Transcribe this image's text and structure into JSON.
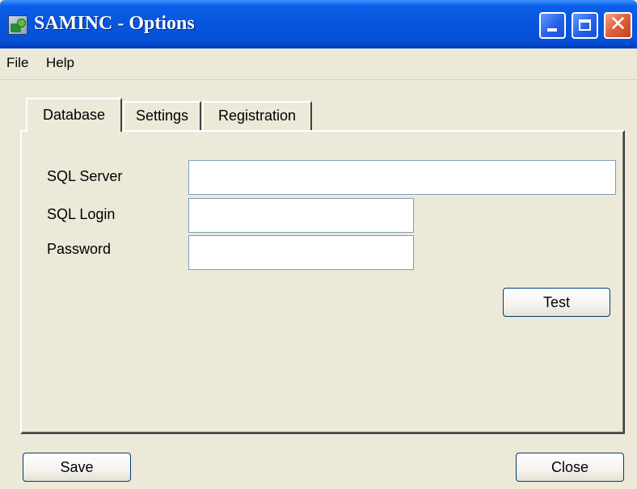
{
  "window": {
    "title": "SAMINC - Options",
    "icon": "app-icon"
  },
  "titlebar": {
    "minimize_icon": "minimize-icon",
    "maximize_icon": "maximize-icon",
    "close_glyph": "✕"
  },
  "menu": {
    "items": [
      {
        "label": "File"
      },
      {
        "label": "Help"
      }
    ]
  },
  "tabs": [
    {
      "label": "Database",
      "active": true
    },
    {
      "label": "Settings",
      "active": false
    },
    {
      "label": "Registration",
      "active": false
    }
  ],
  "database": {
    "sql_server_label": "SQL Server",
    "sql_server_value": "",
    "sql_login_label": "SQL Login",
    "sql_login_value": "",
    "password_label": "Password",
    "password_value": "",
    "test_label": "Test"
  },
  "footer": {
    "save_label": "Save",
    "close_label": "Close"
  },
  "colors": {
    "titlebar": "#0855dd",
    "close_button": "#e0643f",
    "window_bg": "#ece9d8",
    "field_border": "#7f9db9"
  }
}
